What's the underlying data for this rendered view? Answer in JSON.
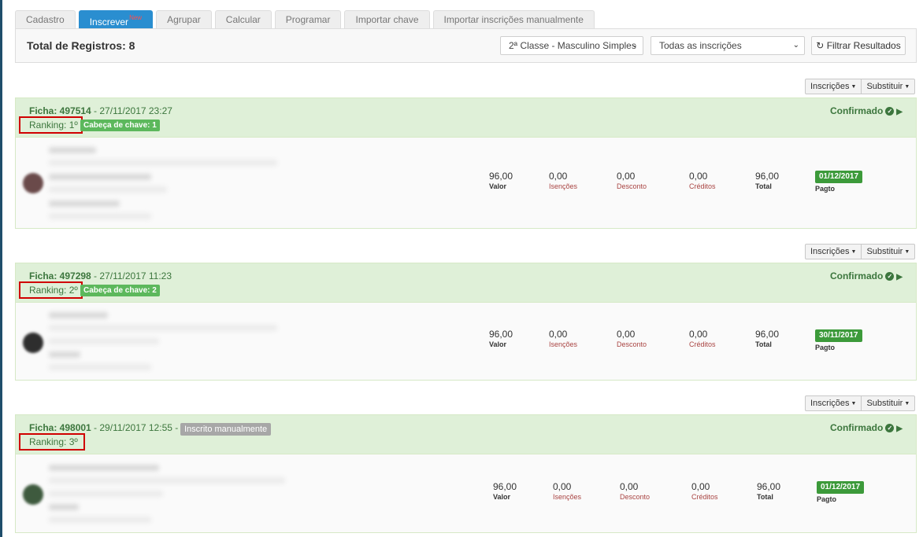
{
  "tabs": [
    {
      "label": "Cadastro",
      "badge": ""
    },
    {
      "label": "Inscrever",
      "badge": "New"
    },
    {
      "label": "Agrupar",
      "badge": ""
    },
    {
      "label": "Calcular",
      "badge": ""
    },
    {
      "label": "Programar",
      "badge": ""
    },
    {
      "label": "Importar chave",
      "badge": ""
    },
    {
      "label": "Importar inscrições manualmente",
      "badge": ""
    }
  ],
  "header": {
    "total": "Total de Registros: 8",
    "category_select": "2ª Classe - Masculino Simples",
    "status_select": "Todas as inscrições",
    "filter_button": "Filtrar Resultados"
  },
  "actions": {
    "inscricoes": "Inscrições",
    "substituir": "Substituir"
  },
  "labels": {
    "valor": "Valor",
    "isencoes": "Isenções",
    "desconto": "Desconto",
    "creditos": "Créditos",
    "total": "Total",
    "pagto": "Pagto"
  },
  "records": [
    {
      "ficha": "Ficha: 497514",
      "datetime": " - 27/11/2017 23:27",
      "ranking": "Ranking: 1º",
      "key_badge": "Cabeça de chave: 1",
      "status": "Confirmado",
      "valor": "96,00",
      "isencoes": "0,00",
      "desconto": "0,00",
      "creditos": "0,00",
      "total": "96,00",
      "pay_date": "01/12/2017"
    },
    {
      "ficha": "Ficha: 497298",
      "datetime": " - 27/11/2017 11:23",
      "ranking": "Ranking: 2º",
      "key_badge": "Cabeça de chave: 2",
      "status": "Confirmado",
      "valor": "96,00",
      "isencoes": "0,00",
      "desconto": "0,00",
      "creditos": "0,00",
      "total": "96,00",
      "pay_date": "30/11/2017"
    },
    {
      "ficha": "Ficha: 498001",
      "datetime": " - 29/11/2017 12:55 - ",
      "manual_badge": "Inscrito manualmente",
      "ranking": "Ranking: 3º",
      "status": "Confirmado",
      "valor": "96,00",
      "isencoes": "0,00",
      "desconto": "0,00",
      "creditos": "0,00",
      "total": "96,00",
      "pay_date": "01/12/2017"
    }
  ],
  "icons": {
    "refresh": "refresh-icon",
    "check": "check-circle-icon",
    "play": "play-icon",
    "caret": "caret-down-icon"
  }
}
